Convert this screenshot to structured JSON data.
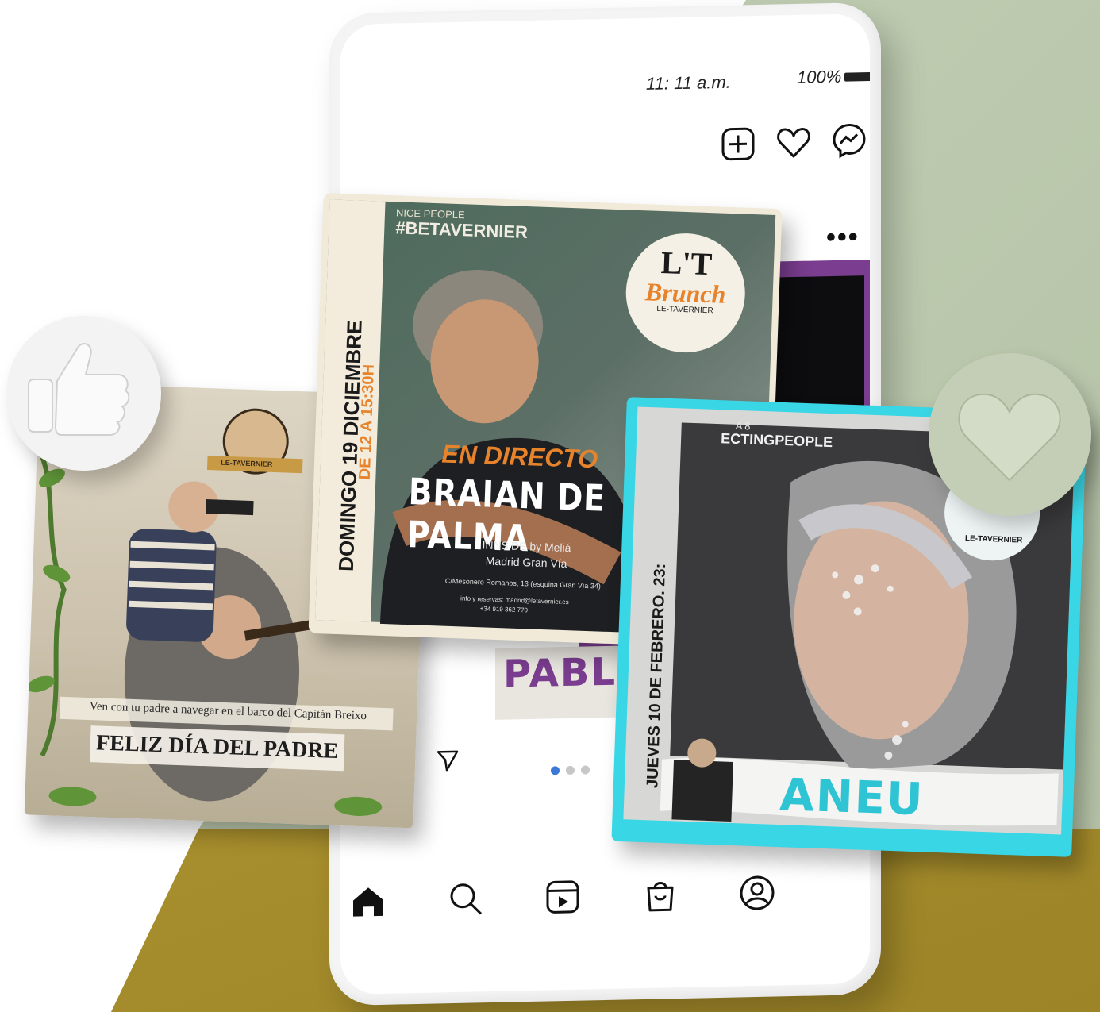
{
  "phone": {
    "status": {
      "time": "11: 11 a.m.",
      "battery": "100%"
    },
    "top_icons": [
      "plus-square-icon",
      "heart-icon",
      "messenger-icon"
    ],
    "more_label": "•••",
    "feed_banner_text": "PABLO BAL",
    "carousel": {
      "count": 3,
      "active": 1
    },
    "bottom_nav": [
      "home-icon",
      "search-icon",
      "reels-icon",
      "shop-icon",
      "profile-icon"
    ]
  },
  "post_left": {
    "caption": "Ven con tu padre a navegar en el barco del Capitán Breixo",
    "title": "FELIZ DÍA DEL PADRE",
    "brand": "LE-TAVERNIER"
  },
  "post_mid": {
    "tag_small": "NICE PEOPLE",
    "hashtag": "#BETAVERNIER",
    "logo_line1": "L'T",
    "logo_line2": "Brunch",
    "logo_line3": "LE-TAVERNIER",
    "headline_small": "EN DIRECTO",
    "headline": "BRAIAN DE PALMA",
    "date": "DOMINGO 19 DICIEMBRE",
    "time": "DE 12 A 15:30H",
    "venue_1": "INNSiDE by Meliá",
    "venue_2": "Madrid Gran Vía",
    "address": "C/Mesonero Romanos, 13 (esquina Gran Vía 34)",
    "contact_1": "info y reservas: madrid@letavernier.es",
    "contact_2": "+34 919 362 770"
  },
  "post_right": {
    "tag_line1": "A 8",
    "tag_line2": "ECTINGPEOPLE",
    "date": "JUEVES 10 DE FEBRERO. 23:",
    "name": "ANEU",
    "brand": "LE-TAVERNIER"
  },
  "colors": {
    "accent_orange": "#e7832b",
    "accent_cyan": "#39d6e5",
    "accent_purple": "#7a3d8f",
    "sage": "#b6c4a8",
    "gold": "#ac932f"
  }
}
